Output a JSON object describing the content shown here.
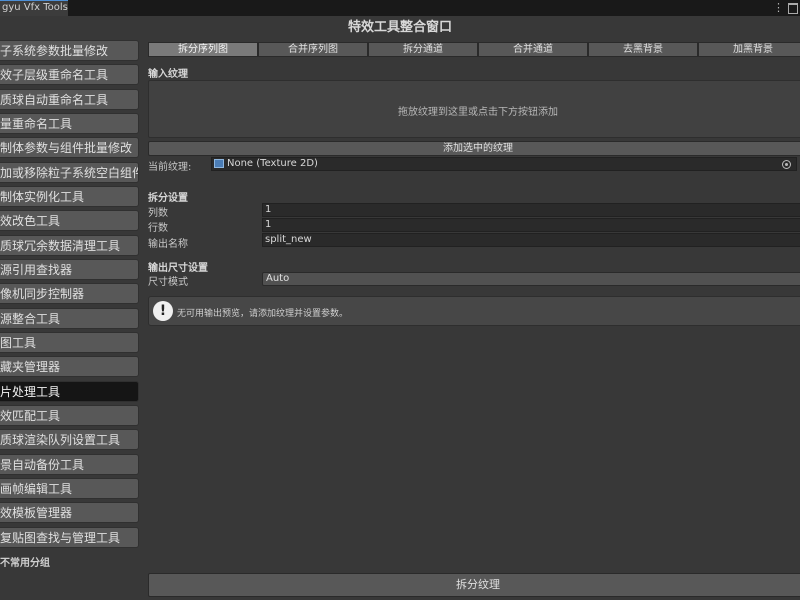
{
  "editor_tab": {
    "title": "gyu Vfx Tools"
  },
  "window": {
    "title": "特效工具整合窗口"
  },
  "sidebar": {
    "items": [
      {
        "label": "子系统参数批量修改"
      },
      {
        "label": "效子层级重命名工具"
      },
      {
        "label": "质球自动重命名工具"
      },
      {
        "label": "量重命名工具"
      },
      {
        "label": "制体参数与组件批量修改"
      },
      {
        "label": "加或移除粒子系统空白组件"
      },
      {
        "label": "制体实例化工具"
      },
      {
        "label": "效改色工具"
      },
      {
        "label": "质球冗余数据清理工具"
      },
      {
        "label": "源引用查找器"
      },
      {
        "label": "像机同步控制器"
      },
      {
        "label": "源整合工具"
      },
      {
        "label": "图工具"
      },
      {
        "label": "藏夹管理器"
      },
      {
        "label": "片处理工具"
      },
      {
        "label": "效匹配工具"
      },
      {
        "label": "质球渲染队列设置工具"
      },
      {
        "label": "景自动备份工具"
      },
      {
        "label": "画帧编辑工具"
      },
      {
        "label": "效模板管理器"
      },
      {
        "label": "复贴图查找与管理工具"
      }
    ],
    "active_index": 14,
    "group_label": "不常用分组"
  },
  "tabs": [
    {
      "label": "拆分序列图"
    },
    {
      "label": "合并序列图"
    },
    {
      "label": "拆分通道"
    },
    {
      "label": "合并通道"
    },
    {
      "label": "去黑背景"
    },
    {
      "label": "加黑背景"
    }
  ],
  "input": {
    "section_title": "输入纹理",
    "drop_hint": "拖放纹理到这里或点击下方按钮添加",
    "add_button": "添加选中的纹理",
    "current_label": "当前纹理:",
    "current_value": "None (Texture 2D)"
  },
  "split": {
    "section_title": "拆分设置",
    "columns_label": "列数",
    "columns_value": "1",
    "rows_label": "行数",
    "rows_value": "1",
    "output_name_label": "输出名称",
    "output_name_value": "split_new"
  },
  "output_size": {
    "section_title": "输出尺寸设置",
    "mode_label": "尺寸模式",
    "mode_value": "Auto"
  },
  "help": {
    "message": "无可用输出预览，请添加纹理并设置参数。"
  },
  "action": {
    "split_button": "拆分纹理"
  },
  "colors": {
    "active_tab": "#7a7a7a",
    "active_sidebar": "#151515",
    "accent": "#4d8fd6"
  }
}
